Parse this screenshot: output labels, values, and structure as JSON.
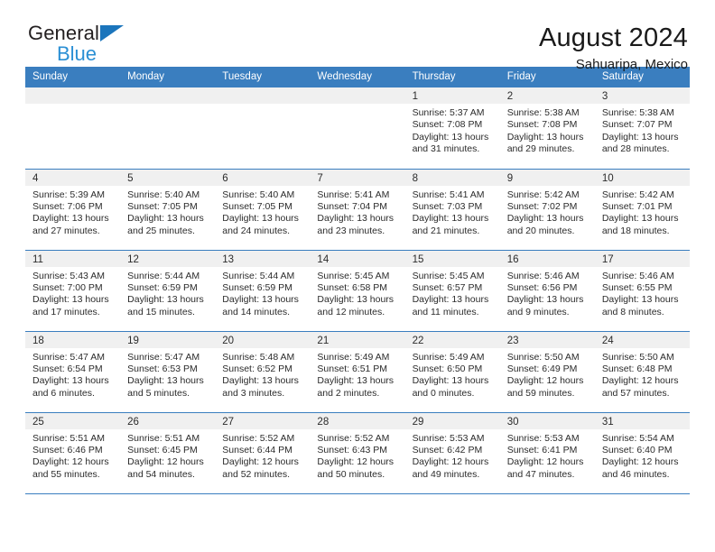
{
  "brand": {
    "name_top": "General",
    "name_bottom": "Blue",
    "mark": "blue-triangle-logo",
    "accent_color": "#2a8fd4"
  },
  "header": {
    "title": "August 2024",
    "subtitle": "Sahuaripa, Mexico"
  },
  "theme": {
    "header_row_color": "#3a7ebf",
    "day_number_band_color": "#f0f0f0",
    "text_color": "#2b2b2b"
  },
  "weekdays": [
    "Sunday",
    "Monday",
    "Tuesday",
    "Wednesday",
    "Thursday",
    "Friday",
    "Saturday"
  ],
  "labels": {
    "sunrise_prefix": "Sunrise:",
    "sunset_prefix": "Sunset:",
    "daylight_prefix": "Daylight:"
  },
  "weeks": [
    [
      {
        "day": "",
        "empty": true
      },
      {
        "day": "",
        "empty": true
      },
      {
        "day": "",
        "empty": true
      },
      {
        "day": "",
        "empty": true
      },
      {
        "day": "1",
        "sunrise": "Sunrise: 5:37 AM",
        "sunset": "Sunset: 7:08 PM",
        "daylight_line1": "Daylight: 13 hours",
        "daylight_line2": "and 31 minutes."
      },
      {
        "day": "2",
        "sunrise": "Sunrise: 5:38 AM",
        "sunset": "Sunset: 7:08 PM",
        "daylight_line1": "Daylight: 13 hours",
        "daylight_line2": "and 29 minutes."
      },
      {
        "day": "3",
        "sunrise": "Sunrise: 5:38 AM",
        "sunset": "Sunset: 7:07 PM",
        "daylight_line1": "Daylight: 13 hours",
        "daylight_line2": "and 28 minutes."
      }
    ],
    [
      {
        "day": "4",
        "sunrise": "Sunrise: 5:39 AM",
        "sunset": "Sunset: 7:06 PM",
        "daylight_line1": "Daylight: 13 hours",
        "daylight_line2": "and 27 minutes."
      },
      {
        "day": "5",
        "sunrise": "Sunrise: 5:40 AM",
        "sunset": "Sunset: 7:05 PM",
        "daylight_line1": "Daylight: 13 hours",
        "daylight_line2": "and 25 minutes."
      },
      {
        "day": "6",
        "sunrise": "Sunrise: 5:40 AM",
        "sunset": "Sunset: 7:05 PM",
        "daylight_line1": "Daylight: 13 hours",
        "daylight_line2": "and 24 minutes."
      },
      {
        "day": "7",
        "sunrise": "Sunrise: 5:41 AM",
        "sunset": "Sunset: 7:04 PM",
        "daylight_line1": "Daylight: 13 hours",
        "daylight_line2": "and 23 minutes."
      },
      {
        "day": "8",
        "sunrise": "Sunrise: 5:41 AM",
        "sunset": "Sunset: 7:03 PM",
        "daylight_line1": "Daylight: 13 hours",
        "daylight_line2": "and 21 minutes."
      },
      {
        "day": "9",
        "sunrise": "Sunrise: 5:42 AM",
        "sunset": "Sunset: 7:02 PM",
        "daylight_line1": "Daylight: 13 hours",
        "daylight_line2": "and 20 minutes."
      },
      {
        "day": "10",
        "sunrise": "Sunrise: 5:42 AM",
        "sunset": "Sunset: 7:01 PM",
        "daylight_line1": "Daylight: 13 hours",
        "daylight_line2": "and 18 minutes."
      }
    ],
    [
      {
        "day": "11",
        "sunrise": "Sunrise: 5:43 AM",
        "sunset": "Sunset: 7:00 PM",
        "daylight_line1": "Daylight: 13 hours",
        "daylight_line2": "and 17 minutes."
      },
      {
        "day": "12",
        "sunrise": "Sunrise: 5:44 AM",
        "sunset": "Sunset: 6:59 PM",
        "daylight_line1": "Daylight: 13 hours",
        "daylight_line2": "and 15 minutes."
      },
      {
        "day": "13",
        "sunrise": "Sunrise: 5:44 AM",
        "sunset": "Sunset: 6:59 PM",
        "daylight_line1": "Daylight: 13 hours",
        "daylight_line2": "and 14 minutes."
      },
      {
        "day": "14",
        "sunrise": "Sunrise: 5:45 AM",
        "sunset": "Sunset: 6:58 PM",
        "daylight_line1": "Daylight: 13 hours",
        "daylight_line2": "and 12 minutes."
      },
      {
        "day": "15",
        "sunrise": "Sunrise: 5:45 AM",
        "sunset": "Sunset: 6:57 PM",
        "daylight_line1": "Daylight: 13 hours",
        "daylight_line2": "and 11 minutes."
      },
      {
        "day": "16",
        "sunrise": "Sunrise: 5:46 AM",
        "sunset": "Sunset: 6:56 PM",
        "daylight_line1": "Daylight: 13 hours",
        "daylight_line2": "and 9 minutes."
      },
      {
        "day": "17",
        "sunrise": "Sunrise: 5:46 AM",
        "sunset": "Sunset: 6:55 PM",
        "daylight_line1": "Daylight: 13 hours",
        "daylight_line2": "and 8 minutes."
      }
    ],
    [
      {
        "day": "18",
        "sunrise": "Sunrise: 5:47 AM",
        "sunset": "Sunset: 6:54 PM",
        "daylight_line1": "Daylight: 13 hours",
        "daylight_line2": "and 6 minutes."
      },
      {
        "day": "19",
        "sunrise": "Sunrise: 5:47 AM",
        "sunset": "Sunset: 6:53 PM",
        "daylight_line1": "Daylight: 13 hours",
        "daylight_line2": "and 5 minutes."
      },
      {
        "day": "20",
        "sunrise": "Sunrise: 5:48 AM",
        "sunset": "Sunset: 6:52 PM",
        "daylight_line1": "Daylight: 13 hours",
        "daylight_line2": "and 3 minutes."
      },
      {
        "day": "21",
        "sunrise": "Sunrise: 5:49 AM",
        "sunset": "Sunset: 6:51 PM",
        "daylight_line1": "Daylight: 13 hours",
        "daylight_line2": "and 2 minutes."
      },
      {
        "day": "22",
        "sunrise": "Sunrise: 5:49 AM",
        "sunset": "Sunset: 6:50 PM",
        "daylight_line1": "Daylight: 13 hours",
        "daylight_line2": "and 0 minutes."
      },
      {
        "day": "23",
        "sunrise": "Sunrise: 5:50 AM",
        "sunset": "Sunset: 6:49 PM",
        "daylight_line1": "Daylight: 12 hours",
        "daylight_line2": "and 59 minutes."
      },
      {
        "day": "24",
        "sunrise": "Sunrise: 5:50 AM",
        "sunset": "Sunset: 6:48 PM",
        "daylight_line1": "Daylight: 12 hours",
        "daylight_line2": "and 57 minutes."
      }
    ],
    [
      {
        "day": "25",
        "sunrise": "Sunrise: 5:51 AM",
        "sunset": "Sunset: 6:46 PM",
        "daylight_line1": "Daylight: 12 hours",
        "daylight_line2": "and 55 minutes."
      },
      {
        "day": "26",
        "sunrise": "Sunrise: 5:51 AM",
        "sunset": "Sunset: 6:45 PM",
        "daylight_line1": "Daylight: 12 hours",
        "daylight_line2": "and 54 minutes."
      },
      {
        "day": "27",
        "sunrise": "Sunrise: 5:52 AM",
        "sunset": "Sunset: 6:44 PM",
        "daylight_line1": "Daylight: 12 hours",
        "daylight_line2": "and 52 minutes."
      },
      {
        "day": "28",
        "sunrise": "Sunrise: 5:52 AM",
        "sunset": "Sunset: 6:43 PM",
        "daylight_line1": "Daylight: 12 hours",
        "daylight_line2": "and 50 minutes."
      },
      {
        "day": "29",
        "sunrise": "Sunrise: 5:53 AM",
        "sunset": "Sunset: 6:42 PM",
        "daylight_line1": "Daylight: 12 hours",
        "daylight_line2": "and 49 minutes."
      },
      {
        "day": "30",
        "sunrise": "Sunrise: 5:53 AM",
        "sunset": "Sunset: 6:41 PM",
        "daylight_line1": "Daylight: 12 hours",
        "daylight_line2": "and 47 minutes."
      },
      {
        "day": "31",
        "sunrise": "Sunrise: 5:54 AM",
        "sunset": "Sunset: 6:40 PM",
        "daylight_line1": "Daylight: 12 hours",
        "daylight_line2": "and 46 minutes."
      }
    ]
  ]
}
